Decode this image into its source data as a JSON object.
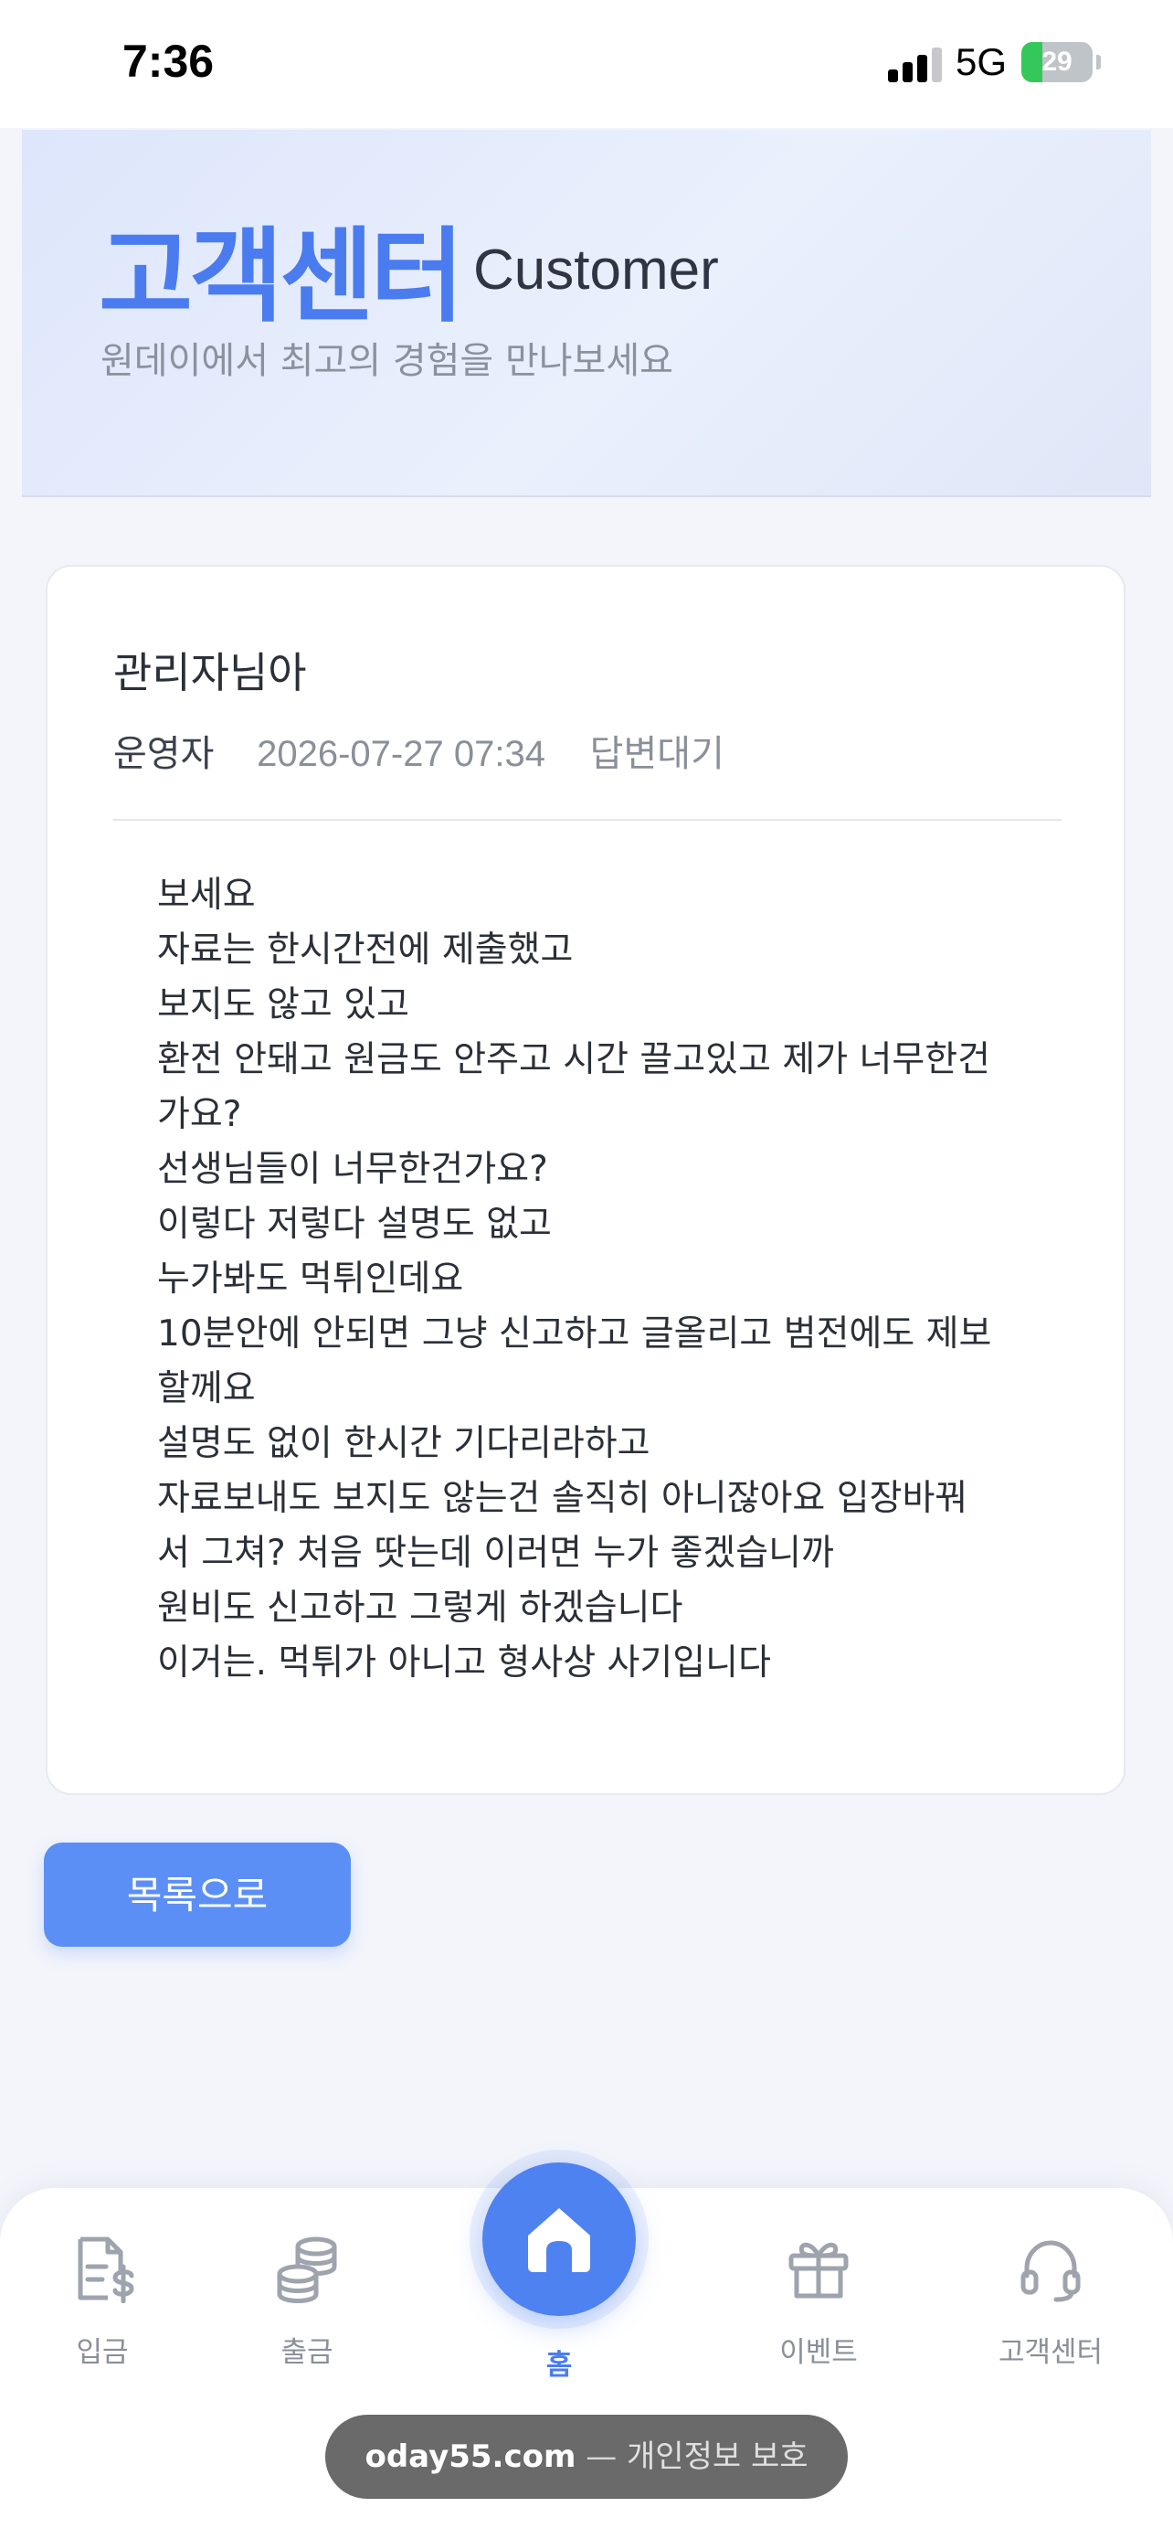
{
  "status_bar": {
    "time": "7:36",
    "network": "5G",
    "battery": "29",
    "battery_level_percent": 29,
    "battery_color": "#34c759"
  },
  "header": {
    "title": "고객센터",
    "subtitle_en": "Customer",
    "description": "원데이에서 최고의 경험을 만나보세요"
  },
  "post": {
    "title": "관리자님아",
    "author": "운영자",
    "date": "2026-07-27 07:34",
    "status": "답변대기",
    "content_lines": [
      "보세요",
      "자료는 한시간전에 제출했고",
      "보지도 않고 있고",
      "환전 안돼고 원금도 안주고 시간 끌고있고 제가 너무한건",
      "가요?",
      "선생님들이 너무한건가요?",
      "이렇다 저렇다 설명도 없고",
      "누가봐도 먹튀인데요",
      "10분안에 안되면 그냥 신고하고 글올리고 범전에도 제보",
      "할께요",
      "설명도 없이 한시간 기다리라하고",
      "자료보내도 보지도 않는건 솔직히 아니잖아요 입장바꿔",
      "서 그쳐? 처음 땃는데 이러면 누가 좋겠습니까",
      "원비도 신고하고 그렇게 하겠습니다",
      "이거는. 먹튀가 아니고 형사상 사기입니다"
    ]
  },
  "actions": {
    "back_label": "목록으로"
  },
  "tab_bar": {
    "deposit": {
      "label": "입금",
      "icon": "receipt-dollar-icon"
    },
    "withdraw": {
      "label": "출금",
      "icon": "coins-icon"
    },
    "home": {
      "label": "홈",
      "icon": "home-icon"
    },
    "event": {
      "label": "이벤트",
      "icon": "gift-icon"
    },
    "support": {
      "label": "고객센터",
      "icon": "headset-icon"
    }
  },
  "browser": {
    "domain": "oday55.com",
    "separator": "—",
    "privacy": "개인정보 보호"
  },
  "colors": {
    "accent": "#4a7cf0",
    "button": "#5b8ff6",
    "muted_text": "#8a8f99"
  }
}
